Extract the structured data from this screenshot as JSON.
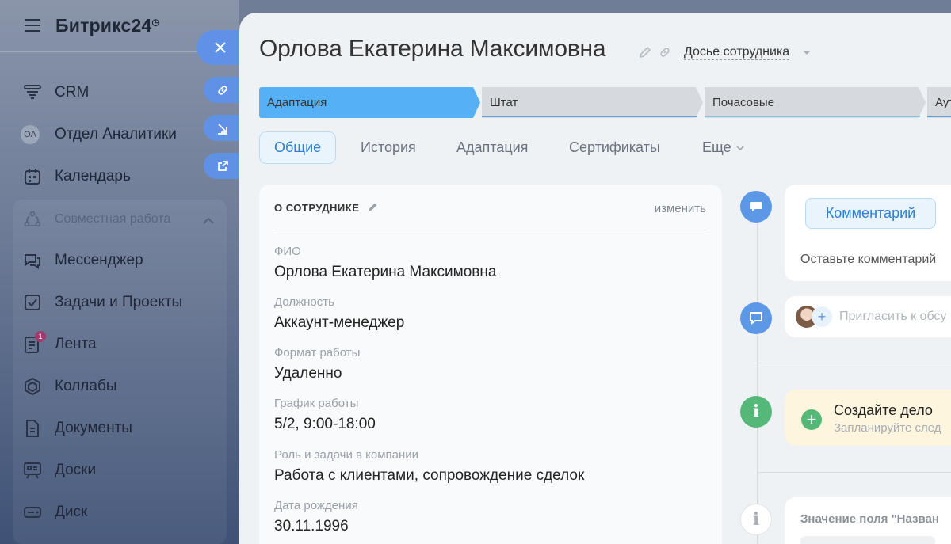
{
  "sidebar": {
    "logo": "Битрикс24",
    "logo_mark": "◷",
    "items": [
      {
        "label": "CRM",
        "icon": "crm-funnel-icon"
      },
      {
        "label": "Отдел Аналитики",
        "icon": "avatar-initials",
        "initials": "ОА"
      },
      {
        "label": "Календарь",
        "icon": "calendar-icon"
      },
      {
        "label": "Совместная работа",
        "icon": "collaboration-icon"
      },
      {
        "label": "Мессенджер",
        "icon": "messenger-icon"
      },
      {
        "label": "Задачи и Проекты",
        "icon": "tasks-icon"
      },
      {
        "label": "Лента",
        "icon": "feed-icon",
        "badge": "1"
      },
      {
        "label": "Коллабы",
        "icon": "collab-icon"
      },
      {
        "label": "Документы",
        "icon": "documents-icon"
      },
      {
        "label": "Доски",
        "icon": "boards-icon"
      },
      {
        "label": "Диск",
        "icon": "disk-icon"
      }
    ]
  },
  "header": {
    "title": "Орлова Екатерина Максимовна",
    "dossier": "Досье сотрудника"
  },
  "stages": [
    "Адаптация",
    "Штат",
    "Почасовые",
    "Аут"
  ],
  "tabs": [
    "Общие",
    "История",
    "Адаптация",
    "Сертификаты",
    "Еще"
  ],
  "about": {
    "heading": "О СОТРУДНИКЕ",
    "edit": "изменить",
    "fields": [
      {
        "label": "ФИО",
        "value": "Орлова Екатерина Максимовна"
      },
      {
        "label": "Должность",
        "value": "Аккаунт-менеджер"
      },
      {
        "label": "Формат работы",
        "value": "Удаленно"
      },
      {
        "label": "График работы",
        "value": "5/2, 9:00-18:00"
      },
      {
        "label": "Роль и задачи в компании",
        "value": "Работа с клиентами, сопровождение сделок"
      },
      {
        "label": "Дата рождения",
        "value": "30.11.1996"
      }
    ]
  },
  "timeline": {
    "comment_button": "Комментарий",
    "comment_placeholder": "Оставьте комментарий",
    "invite_placeholder": "Пригласить к обсу",
    "create_title": "Создайте дело",
    "create_sub": "Запланируйте след",
    "field_change": "Значение поля \"Назван"
  },
  "colors": {
    "accent": "#55b0f5",
    "info": "#5c98e6",
    "green": "#55b878"
  }
}
